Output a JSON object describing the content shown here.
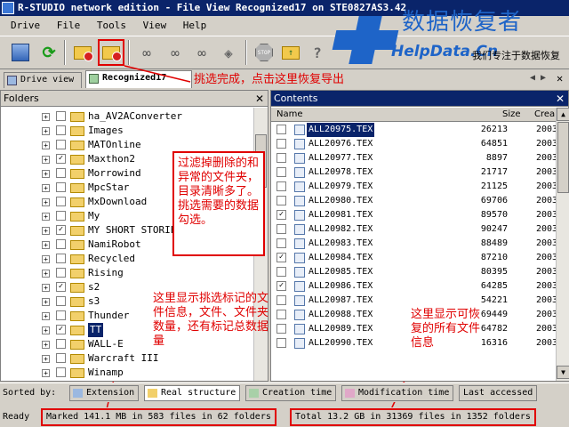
{
  "window": {
    "title": "R-STUDIO network edition - File View Recognized17 on STE0827AS3.42"
  },
  "menu": [
    "Drive",
    "File",
    "Tools",
    "View",
    "Help"
  ],
  "watermark": {
    "title": "数据恢复者",
    "url": "HelpData.Cn",
    "tagline": "我们专注于数据恢复"
  },
  "toolbar_icons": [
    "database-icon",
    "refresh-icon",
    "recover-icon",
    "recover-marked-icon",
    "find-icon",
    "find-next-icon",
    "find-mark-icon",
    "mask-icon",
    "stop-icon",
    "up-folder-icon",
    "help-icon"
  ],
  "tabs": {
    "drive_view": "Drive view",
    "recognized": "Recognized17"
  },
  "folders_pane": {
    "header": "Folders",
    "items": [
      {
        "label": "ha_AV2AConverter",
        "checked": false
      },
      {
        "label": "Images",
        "checked": false
      },
      {
        "label": "MATOnline",
        "checked": false
      },
      {
        "label": "Maxthon2",
        "checked": true
      },
      {
        "label": "Morrowind",
        "checked": false
      },
      {
        "label": "MpcStar",
        "checked": false
      },
      {
        "label": "MxDownload",
        "checked": false
      },
      {
        "label": "My",
        "checked": false
      },
      {
        "label": "MY SHORT STORIES",
        "checked": true
      },
      {
        "label": "NamiRobot",
        "checked": false
      },
      {
        "label": "Recycled",
        "checked": false
      },
      {
        "label": "Rising",
        "checked": false
      },
      {
        "label": "s2",
        "checked": true
      },
      {
        "label": "s3",
        "checked": false
      },
      {
        "label": "Thunder",
        "checked": false
      },
      {
        "label": "TT",
        "checked": true,
        "selected": true
      },
      {
        "label": "WALL-E",
        "checked": false
      },
      {
        "label": "Warcraft III",
        "checked": false
      },
      {
        "label": "Winamp",
        "checked": false
      }
    ]
  },
  "contents_pane": {
    "header": "Contents",
    "columns": {
      "name": "Name",
      "size": "Size",
      "created": "Crea"
    },
    "rows": [
      {
        "name": "ALL20975.TEX",
        "size": "26213",
        "year": "2003",
        "checked": false,
        "selected": true
      },
      {
        "name": "ALL20976.TEX",
        "size": "64851",
        "year": "2003",
        "checked": false
      },
      {
        "name": "ALL20977.TEX",
        "size": "8897",
        "year": "2003",
        "checked": false
      },
      {
        "name": "ALL20978.TEX",
        "size": "21717",
        "year": "2003",
        "checked": false
      },
      {
        "name": "ALL20979.TEX",
        "size": "21125",
        "year": "2003",
        "checked": false
      },
      {
        "name": "ALL20980.TEX",
        "size": "69706",
        "year": "2003",
        "checked": false
      },
      {
        "name": "ALL20981.TEX",
        "size": "89570",
        "year": "2003",
        "checked": true
      },
      {
        "name": "ALL20982.TEX",
        "size": "90247",
        "year": "2003",
        "checked": false
      },
      {
        "name": "ALL20983.TEX",
        "size": "88489",
        "year": "2003",
        "checked": false
      },
      {
        "name": "ALL20984.TEX",
        "size": "87210",
        "year": "2003",
        "checked": true
      },
      {
        "name": "ALL20985.TEX",
        "size": "80395",
        "year": "2003",
        "checked": false
      },
      {
        "name": "ALL20986.TEX",
        "size": "64285",
        "year": "2003",
        "checked": true
      },
      {
        "name": "ALL20987.TEX",
        "size": "54221",
        "year": "2003",
        "checked": false
      },
      {
        "name": "ALL20988.TEX",
        "size": "69449",
        "year": "2003",
        "checked": false
      },
      {
        "name": "ALL20989.TEX",
        "size": "64782",
        "year": "2003",
        "checked": false
      },
      {
        "name": "ALL20990.TEX",
        "size": "16316",
        "year": "2003",
        "checked": false
      }
    ]
  },
  "sort_bar": {
    "label": "Sorted by:",
    "tabs": [
      "Extension",
      "Real structure",
      "Creation time",
      "Modification time",
      "Last accessed"
    ],
    "active": "Real structure"
  },
  "status_bar": {
    "ready": "Ready",
    "marked": "Marked 141.1 MB in 583 files in 62 folders",
    "total": "Total 13.2 GB in 31369 files in 1352 folders"
  },
  "annotations": {
    "toolbar_note": "挑选完成，点击这里恢复导出",
    "filter_note": "过滤掉删除的和异常的文件夹，目录清晰多了。挑选需要的数据勾选。",
    "marked_note": "这里显示挑选标记的文件信息，文件、文件夹数量，还有标记总数据量",
    "total_note": "这里显示可恢复的所有文件信息"
  },
  "colors": {
    "annotation": "#e00000",
    "watermark": "#1e64c8",
    "selection": "#0a246a"
  }
}
